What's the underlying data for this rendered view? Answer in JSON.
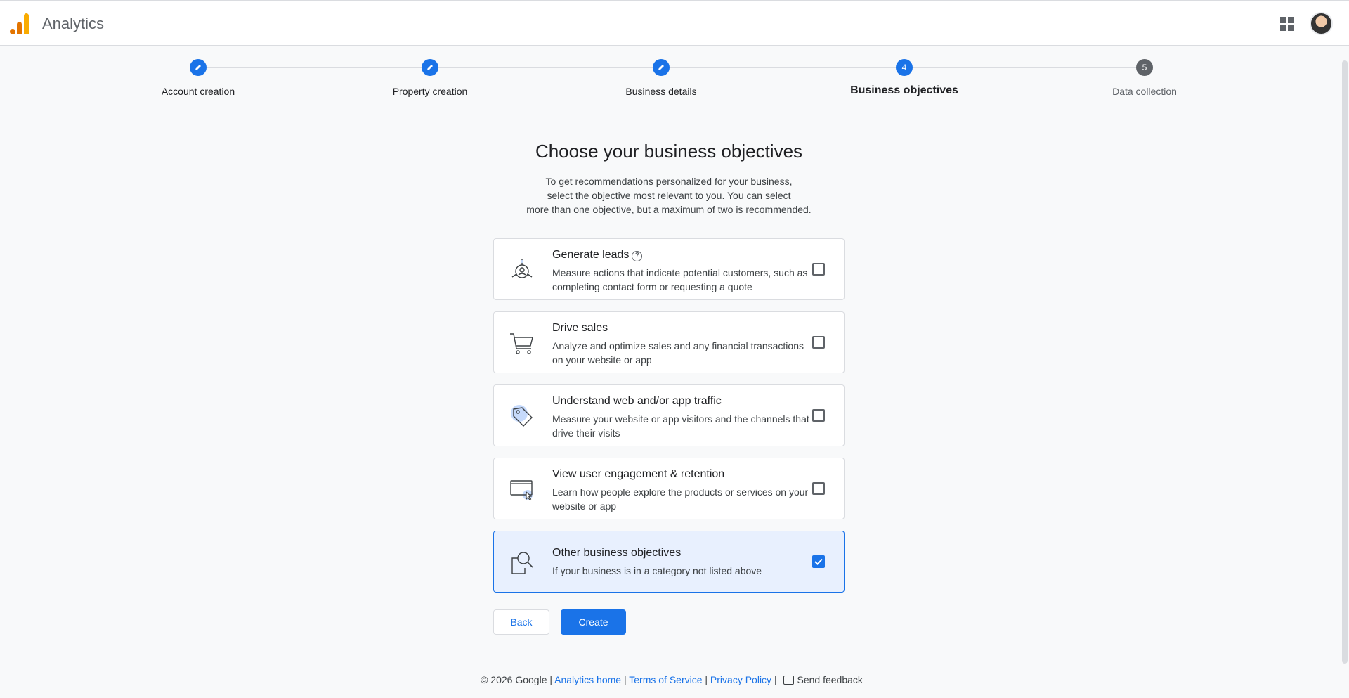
{
  "app": {
    "title": "Analytics"
  },
  "stepper": {
    "steps": [
      {
        "label": "Account creation",
        "state": "done"
      },
      {
        "label": "Property creation",
        "state": "done"
      },
      {
        "label": "Business details",
        "state": "done"
      },
      {
        "label": "Business objectives",
        "number": "4",
        "state": "active"
      },
      {
        "label": "Data collection",
        "number": "5",
        "state": "pending"
      }
    ]
  },
  "page": {
    "heading": "Choose your business objectives",
    "intro_lines": [
      "To get recommendations personalized for your business,",
      "select the objective most relevant to you. You can select",
      "more than one objective, but a maximum of two is recommended."
    ]
  },
  "objectives": [
    {
      "title": "Generate leads",
      "desc": "Measure actions that indicate potential customers, such as completing contact form or requesting a quote",
      "checked": false,
      "icon": "leads-illustration"
    },
    {
      "title": "Drive sales",
      "desc": "Analyze and optimize sales and any financial transactions on your website or app",
      "checked": false,
      "icon": "cart-illustration"
    },
    {
      "title": "Understand web and/or app traffic",
      "desc": "Measure your website or app visitors and the channels that drive their visits",
      "checked": false,
      "icon": "tag-illustration"
    },
    {
      "title": "View user engagement & retention",
      "desc": "Learn how people explore the products or services on your website or app",
      "checked": false,
      "icon": "screen-cursor-illustration"
    },
    {
      "title": "Other business objectives",
      "desc": "If your business is in a category not listed above",
      "checked": true,
      "icon": "magnifier-illustration"
    }
  ],
  "buttons": {
    "back": "Back",
    "create": "Create"
  },
  "footer": {
    "copyright": "© 2026 Google |",
    "analytics_home": "Analytics home",
    "sep": "|",
    "terms": "Terms of Service",
    "privacy": "Privacy Policy",
    "feedback": "Send feedback"
  },
  "colors": {
    "accent": "#1a73e8",
    "selected_bg": "#e8f0fe"
  }
}
